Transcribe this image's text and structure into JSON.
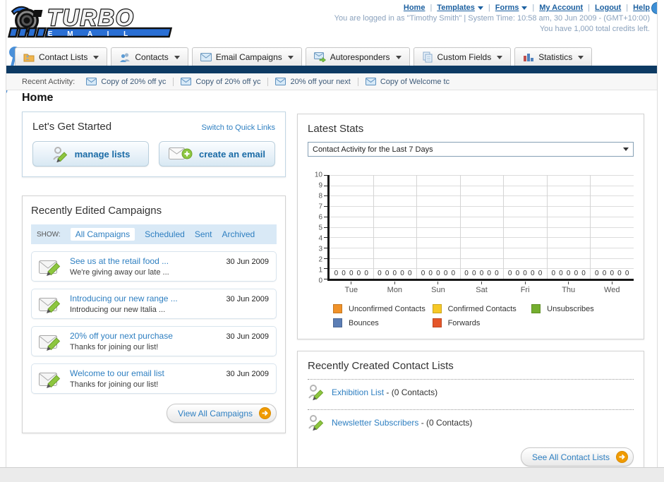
{
  "header": {
    "logo_title": "TURBO",
    "logo_subtitle": "E M A I L",
    "separator": "|",
    "nav": [
      {
        "label": "Home"
      },
      {
        "label": "Templates"
      },
      {
        "label": "Forms"
      },
      {
        "label": "My Account"
      },
      {
        "label": "Logout"
      },
      {
        "label": "Help"
      }
    ],
    "login_line": "You are logged in as \"Timothy Smith\" | System Time: 10:58 am, 30 Jun 2009 - (GMT+10:00)",
    "credits_line": "You have 1,000 total credits left."
  },
  "tabs": [
    {
      "label": "Contact Lists"
    },
    {
      "label": "Contacts"
    },
    {
      "label": "Email Campaigns"
    },
    {
      "label": "Autoresponders"
    },
    {
      "label": "Custom Fields"
    },
    {
      "label": "Statistics"
    }
  ],
  "recent_activity": {
    "label": "Recent Activity:",
    "items": [
      {
        "label": "Copy of 20% off yc"
      },
      {
        "label": "Copy of 20% off yc"
      },
      {
        "label": "20% off your next"
      },
      {
        "label": "Copy of Welcome tc"
      }
    ]
  },
  "page_title": "Home",
  "get_started": {
    "title": "Let's Get Started",
    "switch_link": "Switch to Quick Links",
    "manage_lists_label": "manage lists",
    "create_email_label": "create an email"
  },
  "campaigns": {
    "title": "Recently Edited Campaigns",
    "show_label": "SHOW:",
    "filters": [
      {
        "label": "All Campaigns",
        "active": true
      },
      {
        "label": "Scheduled",
        "active": false
      },
      {
        "label": "Sent",
        "active": false
      },
      {
        "label": "Archived",
        "active": false
      }
    ],
    "items": [
      {
        "title": "See us at the retail food ...",
        "subtitle": "We're giving away our late ...",
        "date": "30 Jun 2009"
      },
      {
        "title": "Introducing our new range ...",
        "subtitle": "Introducing our new Italia ...",
        "date": "30 Jun 2009"
      },
      {
        "title": "20% off your next purchase",
        "subtitle": "Thanks for joining our list!",
        "date": "30 Jun 2009"
      },
      {
        "title": "Welcome to our email list",
        "subtitle": "Thanks for joining our list!",
        "date": "30 Jun 2009"
      }
    ],
    "view_all_label": "View All Campaigns"
  },
  "latest_stats": {
    "title": "Latest Stats",
    "dropdown_value": "Contact Activity for the Last 7 Days"
  },
  "chart_data": {
    "type": "bar",
    "title": "Contact Activity for the Last 7 Days",
    "categories": [
      "Tue",
      "Mon",
      "Sun",
      "Sat",
      "Fri",
      "Thu",
      "Wed"
    ],
    "series": [
      {
        "name": "Unconfirmed Contacts",
        "color": "#F09229",
        "values": [
          0,
          0,
          0,
          0,
          0,
          0,
          0
        ]
      },
      {
        "name": "Confirmed Contacts",
        "color": "#F6C826",
        "values": [
          0,
          0,
          0,
          0,
          0,
          0,
          0
        ]
      },
      {
        "name": "Unsubscribes",
        "color": "#74AE2E",
        "values": [
          0,
          0,
          0,
          0,
          0,
          0,
          0
        ]
      },
      {
        "name": "Bounces",
        "color": "#5C7EB5",
        "values": [
          0,
          0,
          0,
          0,
          0,
          0,
          0
        ]
      },
      {
        "name": "Forwards",
        "color": "#E5562A",
        "values": [
          0,
          0,
          0,
          0,
          0,
          0,
          0
        ]
      }
    ],
    "ylim": [
      0,
      10
    ],
    "ytick_step": 1,
    "grid": true,
    "legend_position": "bottom"
  },
  "contact_lists": {
    "title": "Recently Created Contact Lists",
    "items": [
      {
        "name": "Exhibition List",
        "suffix": " - (0 Contacts)"
      },
      {
        "name": "Newsletter Subscribers",
        "suffix": " - (0 Contacts)"
      }
    ],
    "see_all_label": "See All Contact Lists"
  }
}
